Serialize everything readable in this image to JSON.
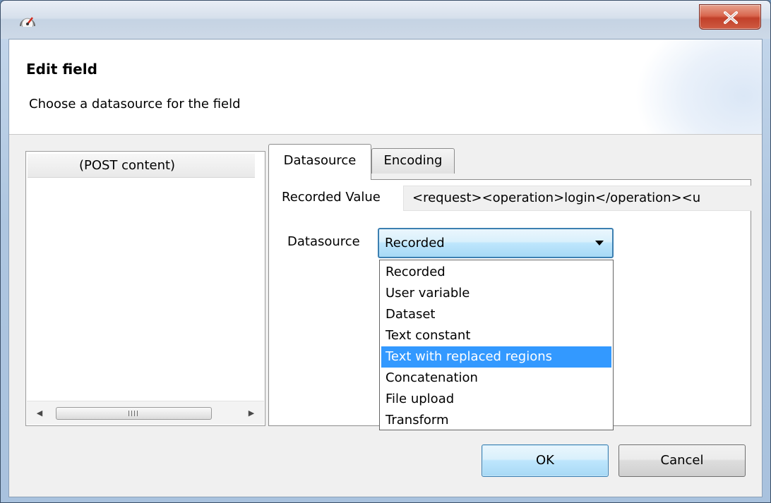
{
  "window": {
    "close_symbol": "X"
  },
  "header": {
    "title": "Edit field",
    "description": "Choose a datasource for the field"
  },
  "field_list": {
    "items": [
      "(POST content)"
    ],
    "scroll_grip": "III"
  },
  "tabs": [
    {
      "label": "Datasource",
      "active": true
    },
    {
      "label": "Encoding",
      "active": false
    }
  ],
  "form": {
    "recorded_value_label": "Recorded Value",
    "recorded_value": "<request><operation>login</operation><u",
    "datasource_label": "Datasource",
    "datasource_selected": "Recorded"
  },
  "dropdown": {
    "options": [
      "Recorded",
      "User variable",
      "Dataset",
      "Text constant",
      "Text with replaced regions",
      "Concatenation",
      "File upload",
      "Transform"
    ],
    "highlighted": "Text with replaced regions"
  },
  "buttons": {
    "ok": "OK",
    "cancel": "Cancel"
  },
  "colors": {
    "selection": "#3399ff",
    "default_button_border": "#3c7fb1",
    "close_button": "#c1402a"
  },
  "icons": [
    "app-icon",
    "close-icon",
    "scroll-left-icon",
    "scroll-right-icon",
    "dropdown-caret-icon"
  ]
}
